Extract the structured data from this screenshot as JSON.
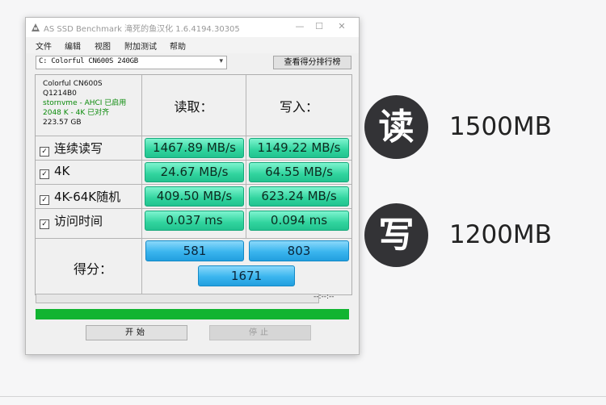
{
  "window": {
    "title": "AS SSD Benchmark 滝死的鱼汉化 1.6.4194.30305",
    "min_glyph": "—",
    "max_glyph": "☐",
    "close_glyph": "✕"
  },
  "menu": [
    "文件",
    "编辑",
    "视图",
    "附加测试",
    "帮助"
  ],
  "drive_select": {
    "value": "C: Colorful CN600S 240GB",
    "arrow": "▾"
  },
  "ranking_button": "查看得分排行榜",
  "info": {
    "model": "Colorful CN600S",
    "firmware": "Q1214B0",
    "driver": "stornvme - AHCI 已启用",
    "align": "2048 K - 4K 已对齐",
    "capacity": "223.57 GB"
  },
  "columns": {
    "read": "读取：",
    "write": "写入："
  },
  "rows": [
    {
      "label": "连续读写",
      "read": "1467.89 MB/s",
      "write": "1149.22 MB/s"
    },
    {
      "label": "4K",
      "read": "24.67 MB/s",
      "write": "64.55 MB/s"
    },
    {
      "label": "4K-64K随机",
      "read": "409.50 MB/s",
      "write": "623.24 MB/s"
    },
    {
      "label": "访问时间",
      "read": "0.037 ms",
      "write": "0.094 ms"
    }
  ],
  "score": {
    "label": "得分：",
    "read": "581",
    "write": "803",
    "total": "1671"
  },
  "progress": {
    "time_text": "--:--:--",
    "status_fill": 1.0
  },
  "buttons": {
    "start": "开始",
    "stop": "停止"
  },
  "badges": {
    "read_char": "读",
    "read_speed": "1500MB",
    "write_char": "写",
    "write_speed": "1200MB"
  },
  "colors": {
    "result_green": "#31d49e",
    "score_blue": "#3ab5ee",
    "progress_green": "#11b431",
    "badge_dark": "#333336"
  }
}
